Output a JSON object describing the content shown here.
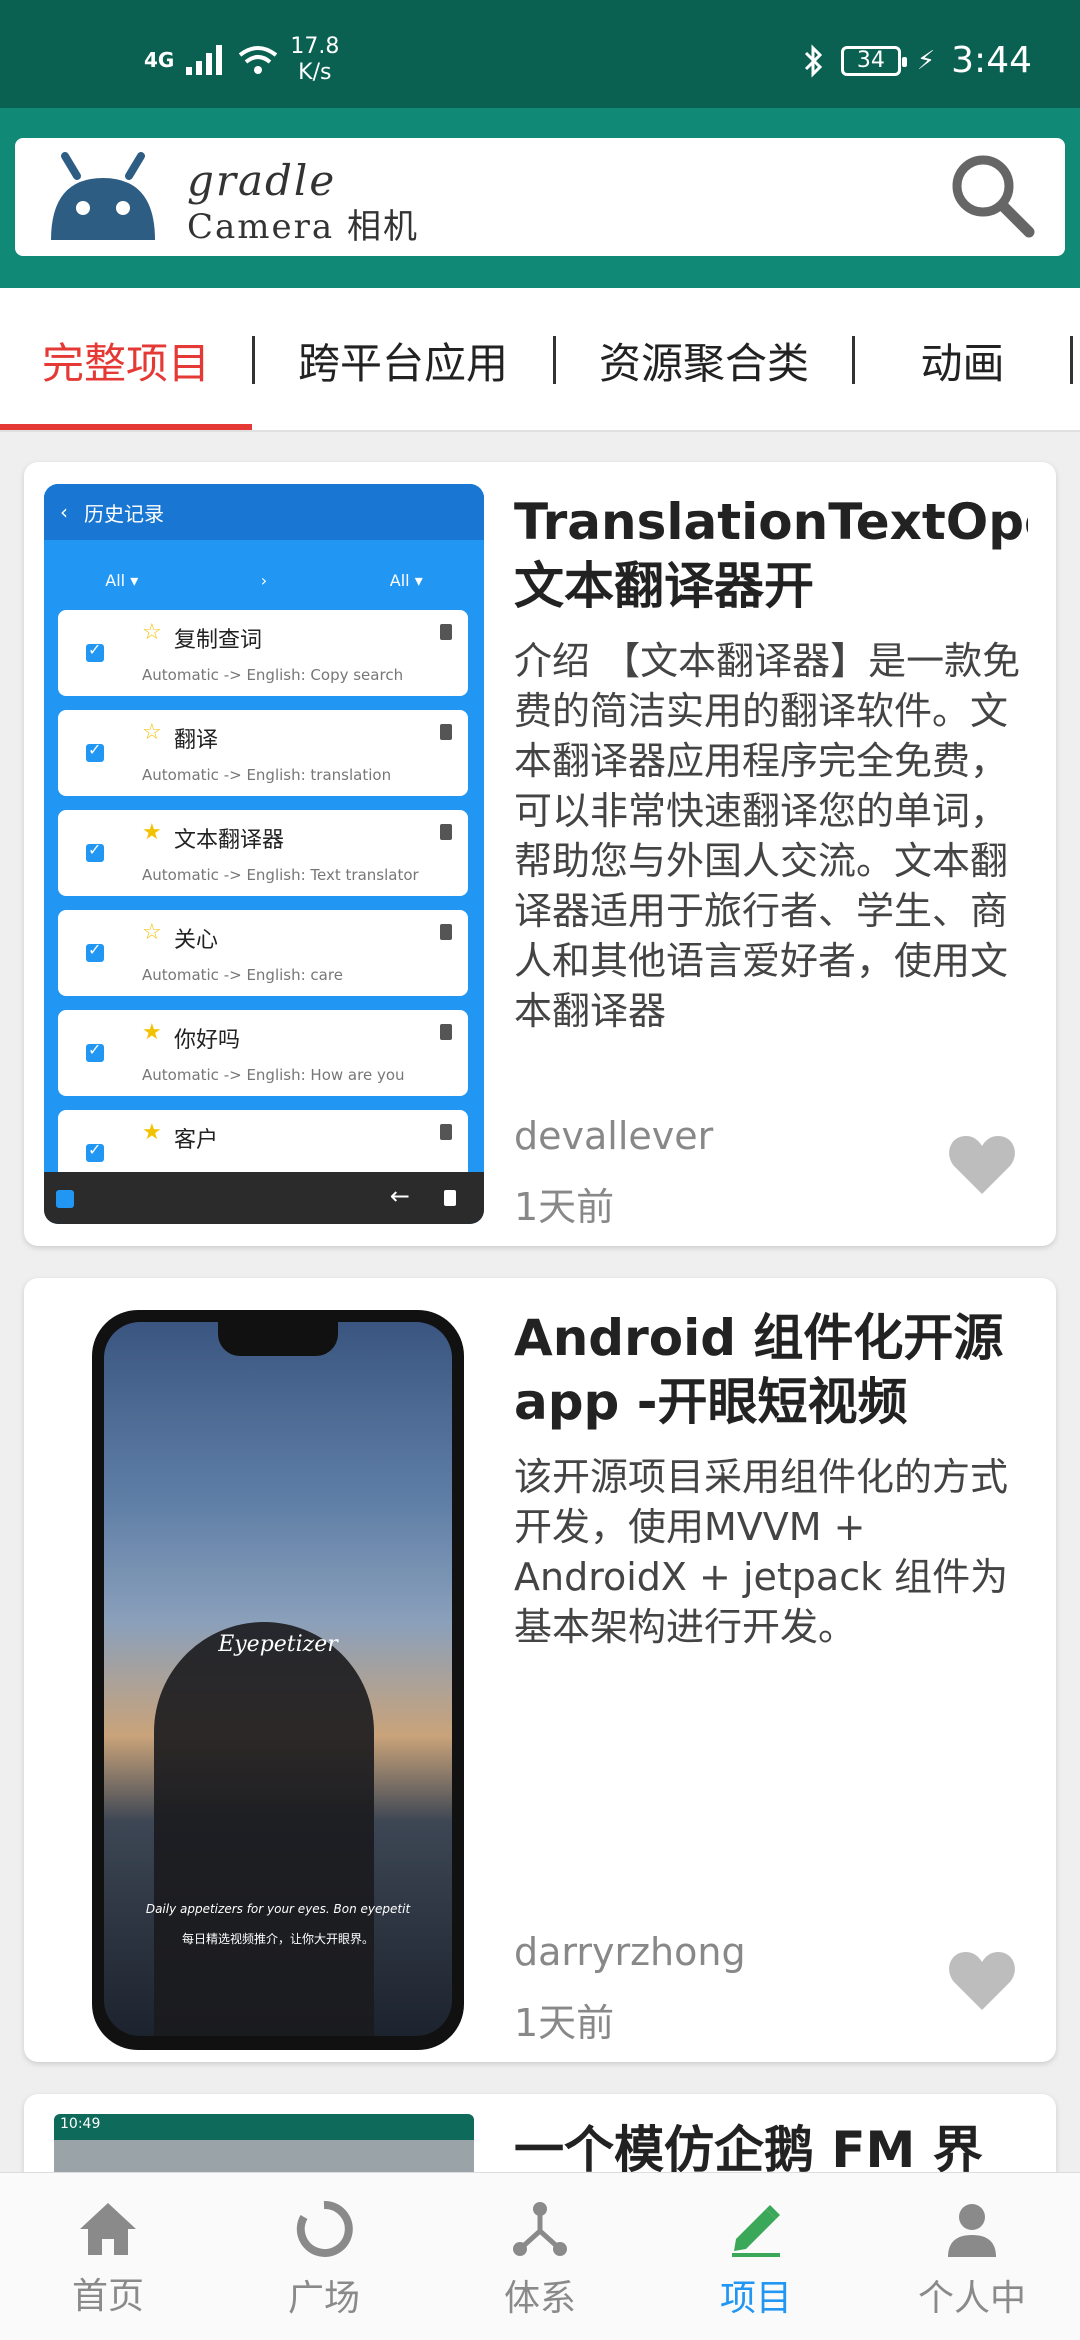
{
  "status_bar": {
    "network": "4G",
    "speed_value": "17.8",
    "speed_unit": "K/s",
    "battery": "34",
    "time": "3:44"
  },
  "header": {
    "brand_top": "gradle",
    "brand_bottom": "Camera 相机",
    "icons": [
      "android-icon",
      "search-icon"
    ]
  },
  "tabs": [
    {
      "label": "完整项目",
      "active": true
    },
    {
      "label": "跨平台应用",
      "active": false
    },
    {
      "label": "资源聚合类",
      "active": false
    },
    {
      "label": "动画",
      "active": false
    }
  ],
  "cards": [
    {
      "title": "TranslationTextOpenSource-文本翻译器开",
      "description": "介绍 【文本翻译器】是一款免费的简洁实用的翻译软件。文本翻译器应用程序完全免费，可以非常快速翻译您的单词，帮助您与外国人交流。文本翻译器适用于旅行者、学生、商人和其他语言爱好者，使用文本翻译器",
      "author": "devallever",
      "time": "1天前",
      "screenshot": {
        "title": "历史记录",
        "filter_left": "All ▾",
        "filter_mid": "›",
        "filter_right": "All ▾",
        "items": [
          {
            "word": "复制查词",
            "starred": false,
            "translation": "Automatic -> English:   Copy search"
          },
          {
            "word": "翻译",
            "starred": false,
            "translation": "Automatic -> English:   translation"
          },
          {
            "word": "文本翻译器",
            "starred": true,
            "translation": "Automatic -> English:   Text translator"
          },
          {
            "word": "关心",
            "starred": false,
            "translation": "Automatic -> English:   care"
          },
          {
            "word": "你好吗",
            "starred": true,
            "translation": "Automatic -> English:   How are you"
          },
          {
            "word": "客户",
            "starred": true,
            "translation": ""
          }
        ]
      }
    },
    {
      "title": "Android 组件化开源app -开眼短视频",
      "description": "该开源项目采用组件化的方式开发，使用MVVM + AndroidX + jetpack 组件为基本架构进行开发。",
      "author": "darryrzhong",
      "time": "1天前",
      "screenshot": {
        "logo": "Eyepetizer",
        "tagline_en": "Daily appetizers for your eyes. Bon eyepetit",
        "tagline_zh": "每日精选视频推介，让你大开眼界。"
      }
    },
    {
      "title": "一个模仿企鹅 FM 界",
      "thumb_status": "10:49"
    }
  ],
  "bottom_nav": [
    {
      "label": "首页",
      "icon": "home-icon",
      "active": false
    },
    {
      "label": "广场",
      "icon": "square-icon",
      "active": false
    },
    {
      "label": "体系",
      "icon": "system-icon",
      "active": false
    },
    {
      "label": "项目",
      "icon": "project-icon",
      "active": true
    },
    {
      "label": "个人中",
      "icon": "person-icon",
      "active": false
    }
  ],
  "colors": {
    "status_bar": "#0a6151",
    "header": "#108a76",
    "tab_active": "#e53935",
    "nav_active": "#2196f3",
    "heart": "#bdbdbd"
  }
}
